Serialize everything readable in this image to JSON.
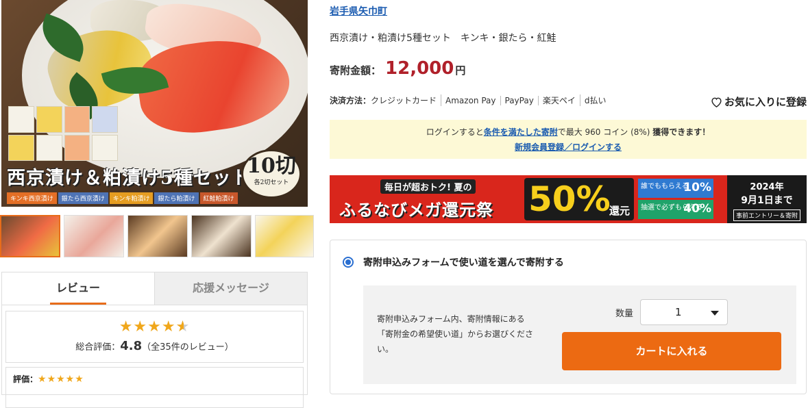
{
  "hero": {
    "title": "西京漬け＆粕漬け5種セット",
    "badge_big": "10切",
    "badge_small": "各2切セット",
    "tags": [
      "キンキ西京漬け",
      "銀たら西京漬け",
      "キンキ粕漬け",
      "銀たら粕漬け",
      "紅鮭粕漬け"
    ]
  },
  "tabs": {
    "review": "レビュー",
    "message": "応援メッセージ"
  },
  "review_summary": {
    "stars_full": "★★★★",
    "stars_half": "★",
    "label": "総合評価：",
    "score": "4.8",
    "count": "（全35件のレビュー）"
  },
  "review_item": {
    "label": "評価：",
    "stars": "★★★★★"
  },
  "product": {
    "municipality": "岩手県矢巾町",
    "title": "西京漬け・粕漬け5種セット　キンキ・銀たら・紅鮭",
    "price_label": "寄附金額：",
    "price": "12,000",
    "price_unit": "円"
  },
  "payment": {
    "label": "決済方法：",
    "methods": [
      "クレジットカード",
      "Amazon Pay",
      "PayPay",
      "楽天ペイ",
      "d払い"
    ]
  },
  "favorite": {
    "label": "お気に入りに登録",
    "icon": "heart-icon"
  },
  "notice": {
    "pre": "ログインすると",
    "link": "条件を満たした寄附",
    "mid": "で最大 960 コイン (8%)",
    "post": "獲得できます！",
    "signup_link": "新規会員登録／ログインする"
  },
  "banner": {
    "tagline": "毎日が超おトク! 夏の",
    "name": "ふるなびメガ還元祭",
    "percent": "50%",
    "kangen": "還元",
    "split1_text": "誰でももらえる",
    "split1_val": "10%",
    "split2_text": "抽選で必ずもらえる",
    "split2_val": "40%",
    "date_year": "2024年",
    "date_end": "9月1日まで",
    "entry": "事前エントリー＆寄附"
  },
  "form": {
    "option_label": "寄附申込みフォームで使い道を選んで寄附する",
    "description": "寄附申込みフォーム内、寄附情報にある「寄附金の希望使い道」からお選びください。",
    "qty_label": "数量",
    "qty_value": "1",
    "cart_button": "カートに入れる"
  },
  "colors": {
    "accent": "#ec6a12",
    "price": "#b0202a",
    "link": "#1a5bb0",
    "star": "#f0a71b"
  }
}
